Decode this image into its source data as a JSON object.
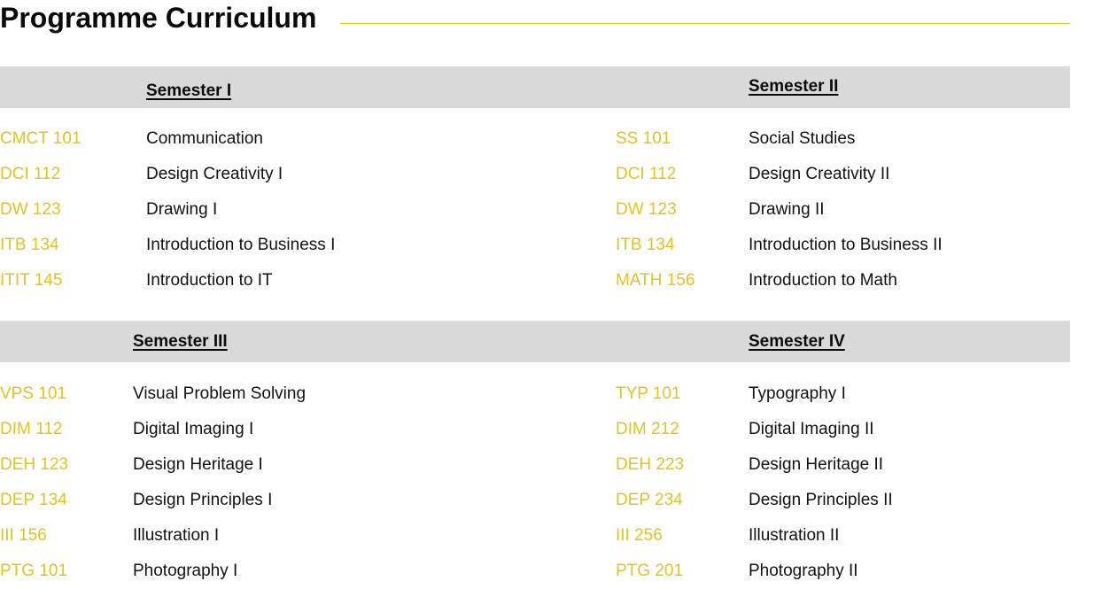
{
  "page": {
    "title": "Programme Curriculum"
  },
  "colors": {
    "accent": "#e6c21e",
    "band": "#d9d9d9",
    "text": "#111111"
  },
  "semesters": [
    {
      "heading": "Semester I",
      "courses": [
        {
          "code": "CMCT 101",
          "name": "Communication"
        },
        {
          "code": "DCI 112",
          "name": "Design Creativity I"
        },
        {
          "code": "DW 123",
          "name": "Drawing I"
        },
        {
          "code": "ITB 134",
          "name": "Introduction to Business I"
        },
        {
          "code": "ITIT 145",
          "name": "Introduction to IT"
        }
      ]
    },
    {
      "heading": "Semester II",
      "courses": [
        {
          "code": "SS 101",
          "name": "Social Studies"
        },
        {
          "code": "DCI 112",
          "name": "Design Creativity II"
        },
        {
          "code": "DW 123",
          "name": "Drawing II"
        },
        {
          "code": "ITB 134",
          "name": "Introduction to Business II"
        },
        {
          "code": "MATH 156",
          "name": "Introduction to Math"
        }
      ]
    },
    {
      "heading": "Semester III",
      "courses": [
        {
          "code": "VPS 101",
          "name": "Visual Problem Solving"
        },
        {
          "code": "DIM 112",
          "name": "Digital Imaging I"
        },
        {
          "code": "DEH 123",
          "name": "Design Heritage I"
        },
        {
          "code": "DEP 134",
          "name": "Design Principles I"
        },
        {
          "code": "III 156",
          "name": "Illustration I"
        },
        {
          "code": "PTG 101",
          "name": "Photography I"
        }
      ]
    },
    {
      "heading": "Semester IV",
      "courses": [
        {
          "code": "TYP 101",
          "name": "Typography I"
        },
        {
          "code": "DIM 212",
          "name": "Digital Imaging II"
        },
        {
          "code": "DEH 223",
          "name": "Design Heritage II"
        },
        {
          "code": "DEP 234",
          "name": "Design Principles II"
        },
        {
          "code": "III 256",
          "name": "Illustration II"
        },
        {
          "code": "PTG 201",
          "name": "Photography II"
        }
      ]
    }
  ]
}
